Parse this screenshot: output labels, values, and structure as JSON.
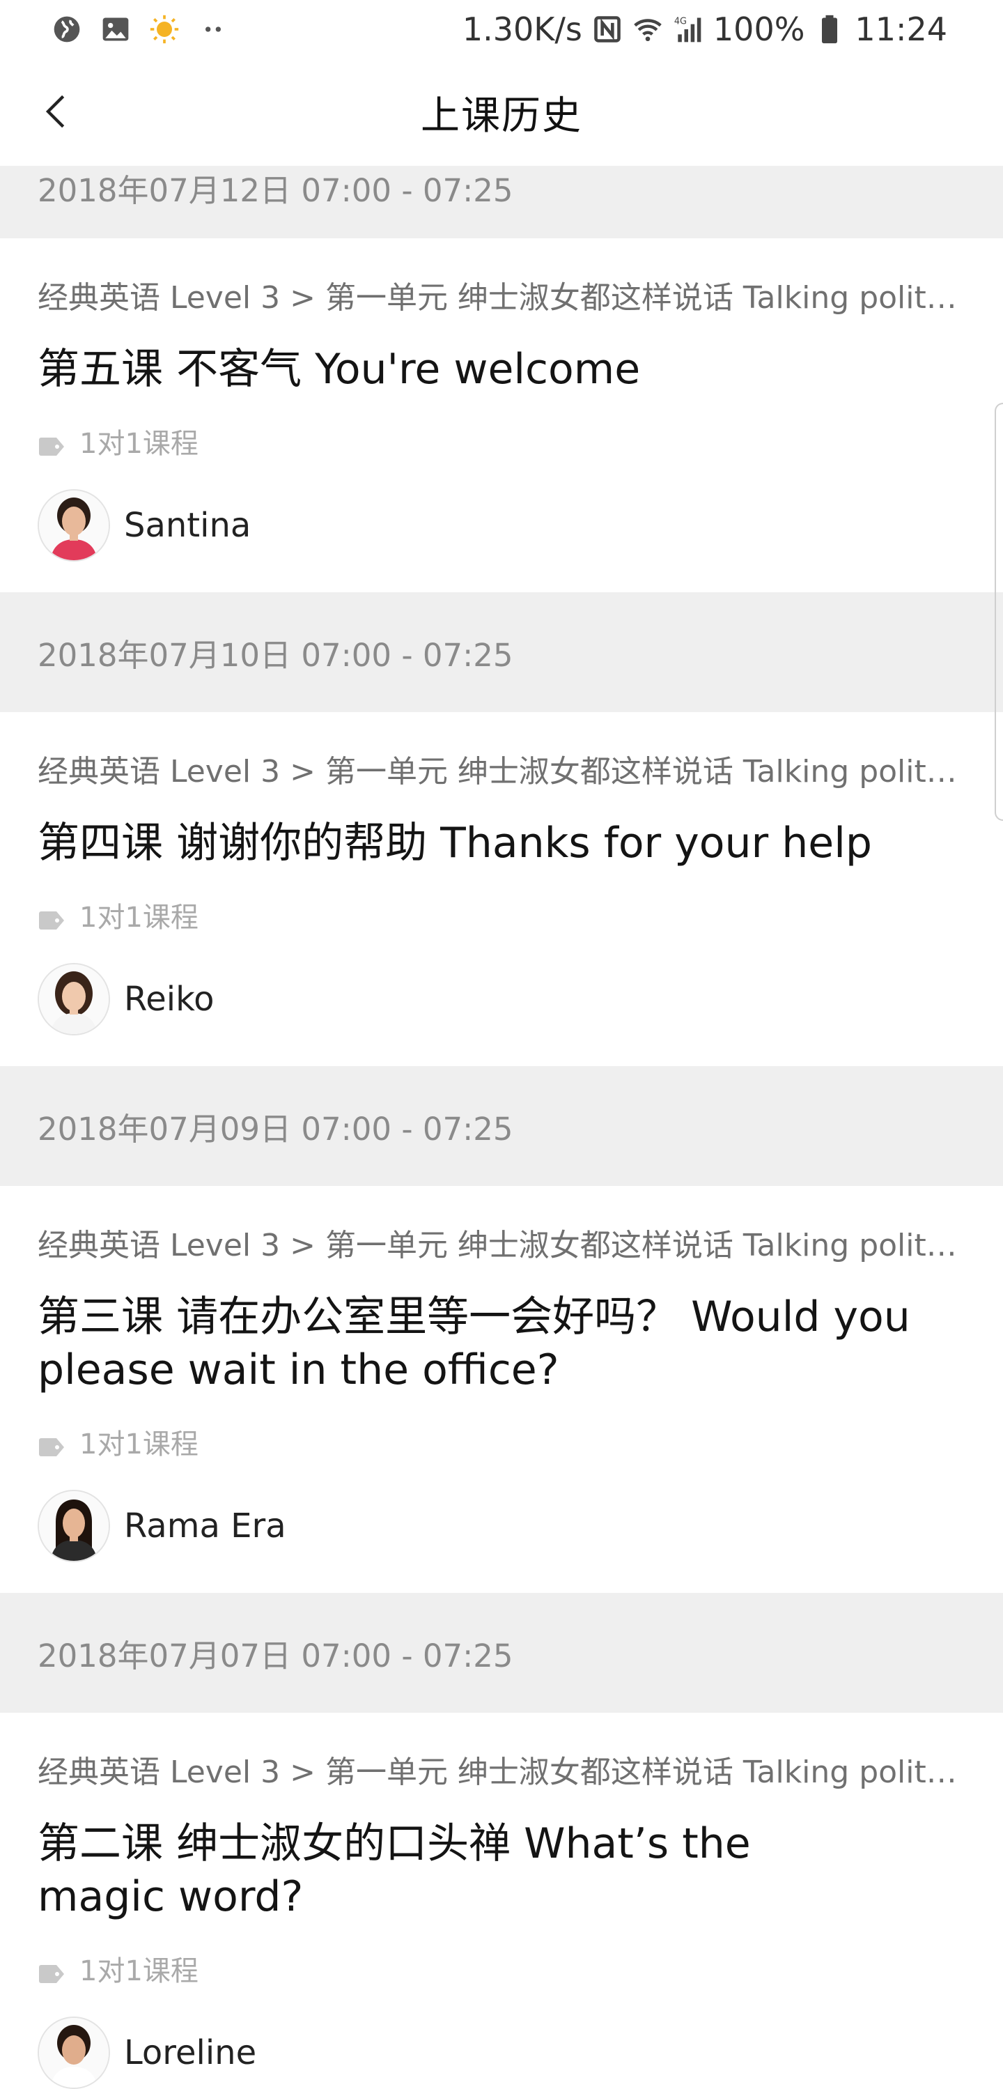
{
  "status_bar": {
    "net_speed": "1.30K/s",
    "battery": "100%",
    "time": "11:24",
    "icons": [
      "globe-icon",
      "gallery-icon",
      "weather-sun-icon",
      "more-dots-icon",
      "nfc-icon",
      "wifi-icon",
      "signal-4g-icon",
      "battery-icon"
    ]
  },
  "header": {
    "title": "上课历史",
    "back_icon": "chevron-left-icon"
  },
  "lessons": [
    {
      "date": "2018年07月12日 07:00 - 07:25",
      "breadcrumb": "经典英语 Level 3 > 第一单元 绅士淑女都这样说话 Talking politely",
      "title": "第五课 不客气 You're welcome",
      "tag": "1对1课程",
      "teacher": "Santina",
      "avatar_colors": {
        "hair": "#2b1d16",
        "skin": "#e8b99a",
        "shirt": "#e23b5a"
      }
    },
    {
      "date": "2018年07月10日 07:00 - 07:25",
      "breadcrumb": "经典英语 Level 3 > 第一单元 绅士淑女都这样说话 Talking politely",
      "title": "第四课 谢谢你的帮助 Thanks for your help",
      "tag": "1对1课程",
      "teacher": "Reiko",
      "avatar_colors": {
        "hair": "#3a2419",
        "skin": "#f0c9ad",
        "shirt": "#f5f5f5"
      }
    },
    {
      "date": "2018年07月09日 07:00 - 07:25",
      "breadcrumb": "经典英语 Level 3 > 第一单元 绅士淑女都这样说话 Talking politely",
      "title": "第三课 请在办公室里等一会好吗？ Would you please wait in the office?",
      "tag": "1对1课程",
      "teacher": "Rama Era",
      "avatar_colors": {
        "hair": "#1e120c",
        "skin": "#e6b594",
        "shirt": "#2b2b2b"
      }
    },
    {
      "date": "2018年07月07日 07:00 - 07:25",
      "breadcrumb": "经典英语 Level 3 > 第一单元 绅士淑女都这样说话 Talking politely",
      "title": "第二课  绅士淑女的口头禅 What’s the magic word?",
      "tag": "1对1课程",
      "teacher": "Loreline",
      "avatar_colors": {
        "hair": "#251710",
        "skin": "#e0ad8c",
        "shirt": "#ffffff"
      }
    }
  ]
}
